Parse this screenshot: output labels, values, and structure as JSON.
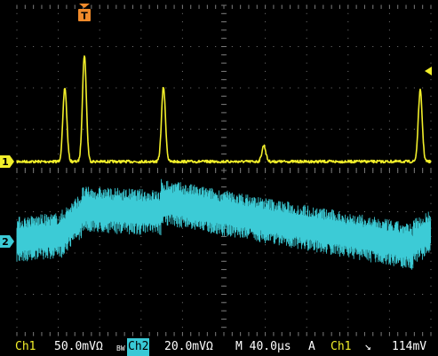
{
  "screen": {
    "background_color": "#000000",
    "grid_color": "#7a7a7a",
    "ch1_color": "#f2ef2a",
    "ch2_color": "#3ccbd6",
    "trigger_marker_color": "#f08a2a"
  },
  "markers": {
    "trigger_position": "T",
    "ch1_ground": "1",
    "ch2_ground": "2"
  },
  "status": {
    "ch1_label": "Ch1",
    "ch1_scale": "50.0mVΩ",
    "ch1_bw": "BW",
    "ch2_label": "Ch2",
    "ch2_scale": "20.0mVΩ",
    "timebase": "M 40.0µs",
    "trigger_mode": "A",
    "trigger_source": "Ch1",
    "trigger_slope": "↘",
    "trigger_level": "114mV"
  }
}
